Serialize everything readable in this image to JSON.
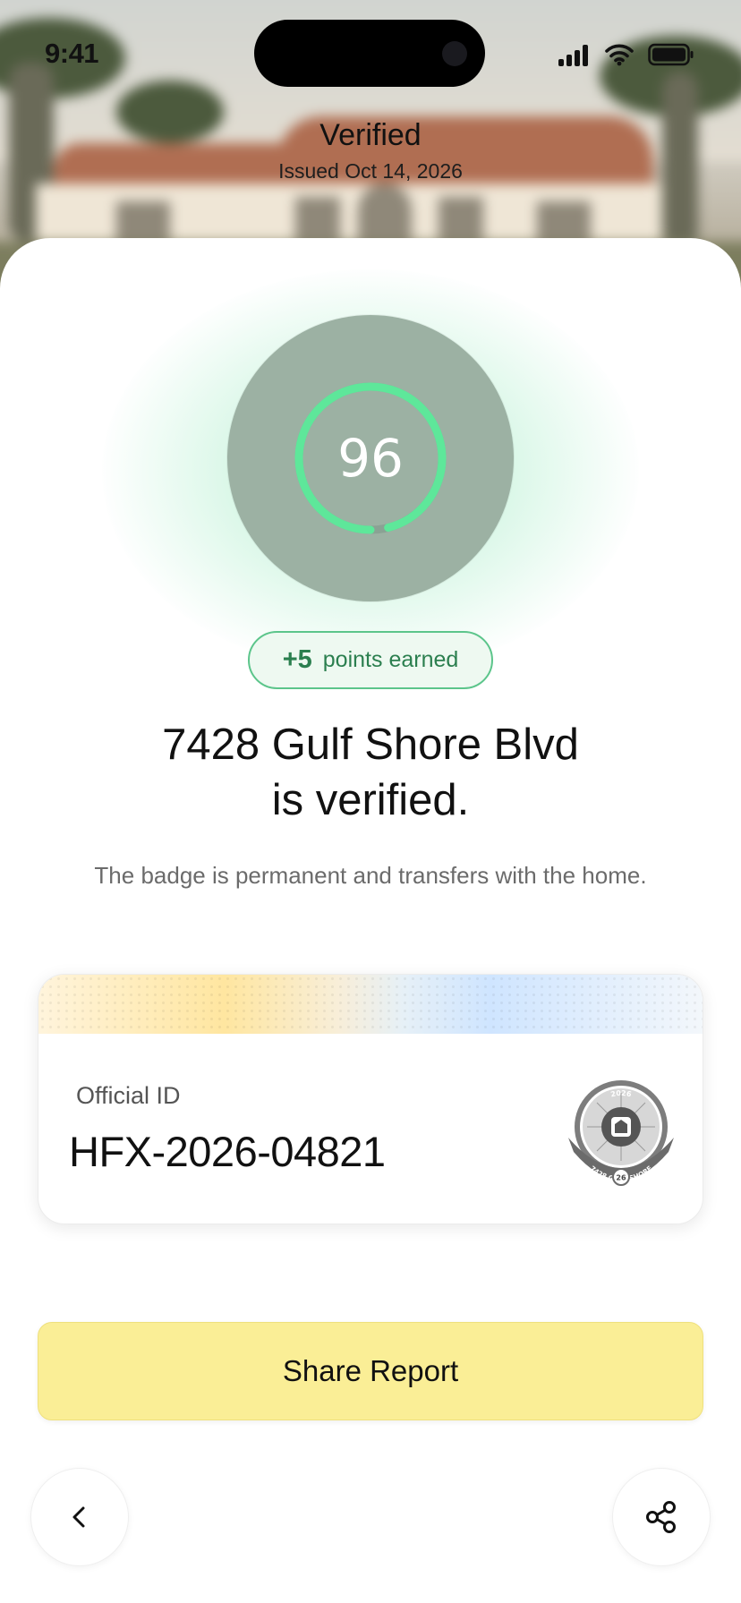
{
  "status_bar": {
    "time": "9:41"
  },
  "header": {
    "title": "Verified",
    "subtitle": "Issued Oct 14, 2026"
  },
  "score": {
    "value": "96",
    "progress_fraction": 0.96,
    "ring_color": "#5ee79a",
    "disc_color": "#9cb1a3"
  },
  "points": {
    "amount": "+5",
    "label": "points earned"
  },
  "headline": {
    "line1": "7428 Gulf Shore Blvd",
    "line2": "is verified."
  },
  "description": "The badge is permanent and transfers with the home.",
  "id_card": {
    "label": "Official ID",
    "value": "HFX-2026-04821",
    "seal": {
      "top_text": "2026",
      "city_text": "NAPLES, FL",
      "ribbon_text": "7428 GULF SHORE",
      "bottom_left": "HOUSEFAX",
      "bottom_right": "CERTIFIED",
      "year_badge": "26"
    }
  },
  "actions": {
    "share_report": "Share Report"
  },
  "icons": {
    "back": "chevron-left-icon",
    "share": "share-nodes-icon"
  },
  "colors": {
    "accent_green": "#5cc58b",
    "button_yellow": "#faee96"
  }
}
